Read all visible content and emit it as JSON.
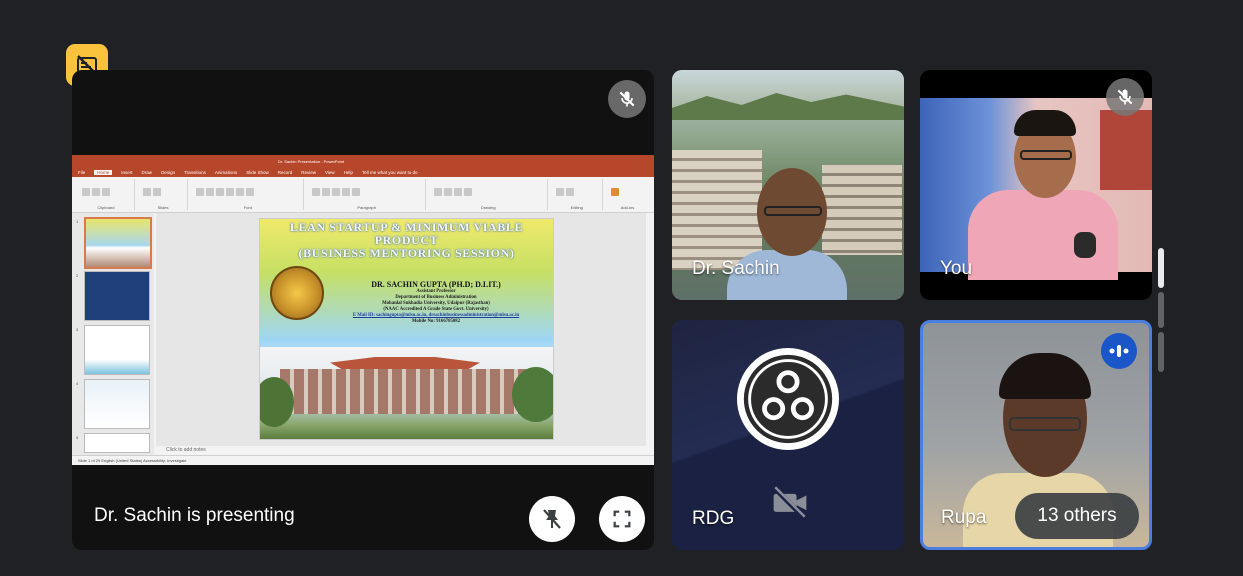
{
  "meeting": {
    "presenting_text": "Dr. Sachin is presenting"
  },
  "powerpoint": {
    "window_title": "Dr. Sachin Presentation - PowerPoint",
    "menu_tabs": [
      "File",
      "Home",
      "Insert",
      "Draw",
      "Design",
      "Transitions",
      "Animations",
      "Slide Show",
      "Record",
      "Review",
      "View",
      "Help"
    ],
    "active_tab": "Home",
    "tell_me": "Tell me what you want to do",
    "ribbon_groups": [
      "Clipboard",
      "Slides",
      "Font",
      "Paragraph",
      "Drawing",
      "Editing",
      "Add-ins"
    ],
    "notes_placeholder": "Click to add notes",
    "status": "Slide 1 of 29   English (United States)   Accessibility: Investigate",
    "slide_numbers": [
      "1",
      "2",
      "3",
      "4",
      "5"
    ],
    "slide": {
      "title_line1": "LEAN STARTUP & MINIMUM VIABLE",
      "title_line2": "PRODUCT",
      "title_line3": "(BUSINESS MENTORING SESSION)",
      "presenter": "DR. SACHIN GUPTA (PH.D; D.LIT.)",
      "role": "Assistant Professor",
      "department": "Department of Business Administration",
      "university": "Mohanlal Sukhadia University, Udaipur (Rajasthan)",
      "accreditation": "(NAAC Accredited A Grade State Govt. University)",
      "email": "E Mail ID: sachingupta@mlsu.ac.in, drsachinbusinessadministration@mlsu.ac.in",
      "mobile": "Mobile No: 9166785082"
    }
  },
  "participants": [
    {
      "name": "Dr. Sachin"
    },
    {
      "name": "You"
    },
    {
      "name": "RDG"
    },
    {
      "name": "Rupa"
    }
  ],
  "others_chip": "13 others",
  "colors": {
    "background": "#202124",
    "badge_yellow": "#f9c23c",
    "speaking_blue": "#1a56c8",
    "ppt_red": "#b7472a"
  },
  "icons": [
    "no-captions-icon",
    "mic-off-icon",
    "unpin-icon",
    "fullscreen-icon",
    "camera-off-icon",
    "speaking-icon",
    "obs-logo"
  ]
}
